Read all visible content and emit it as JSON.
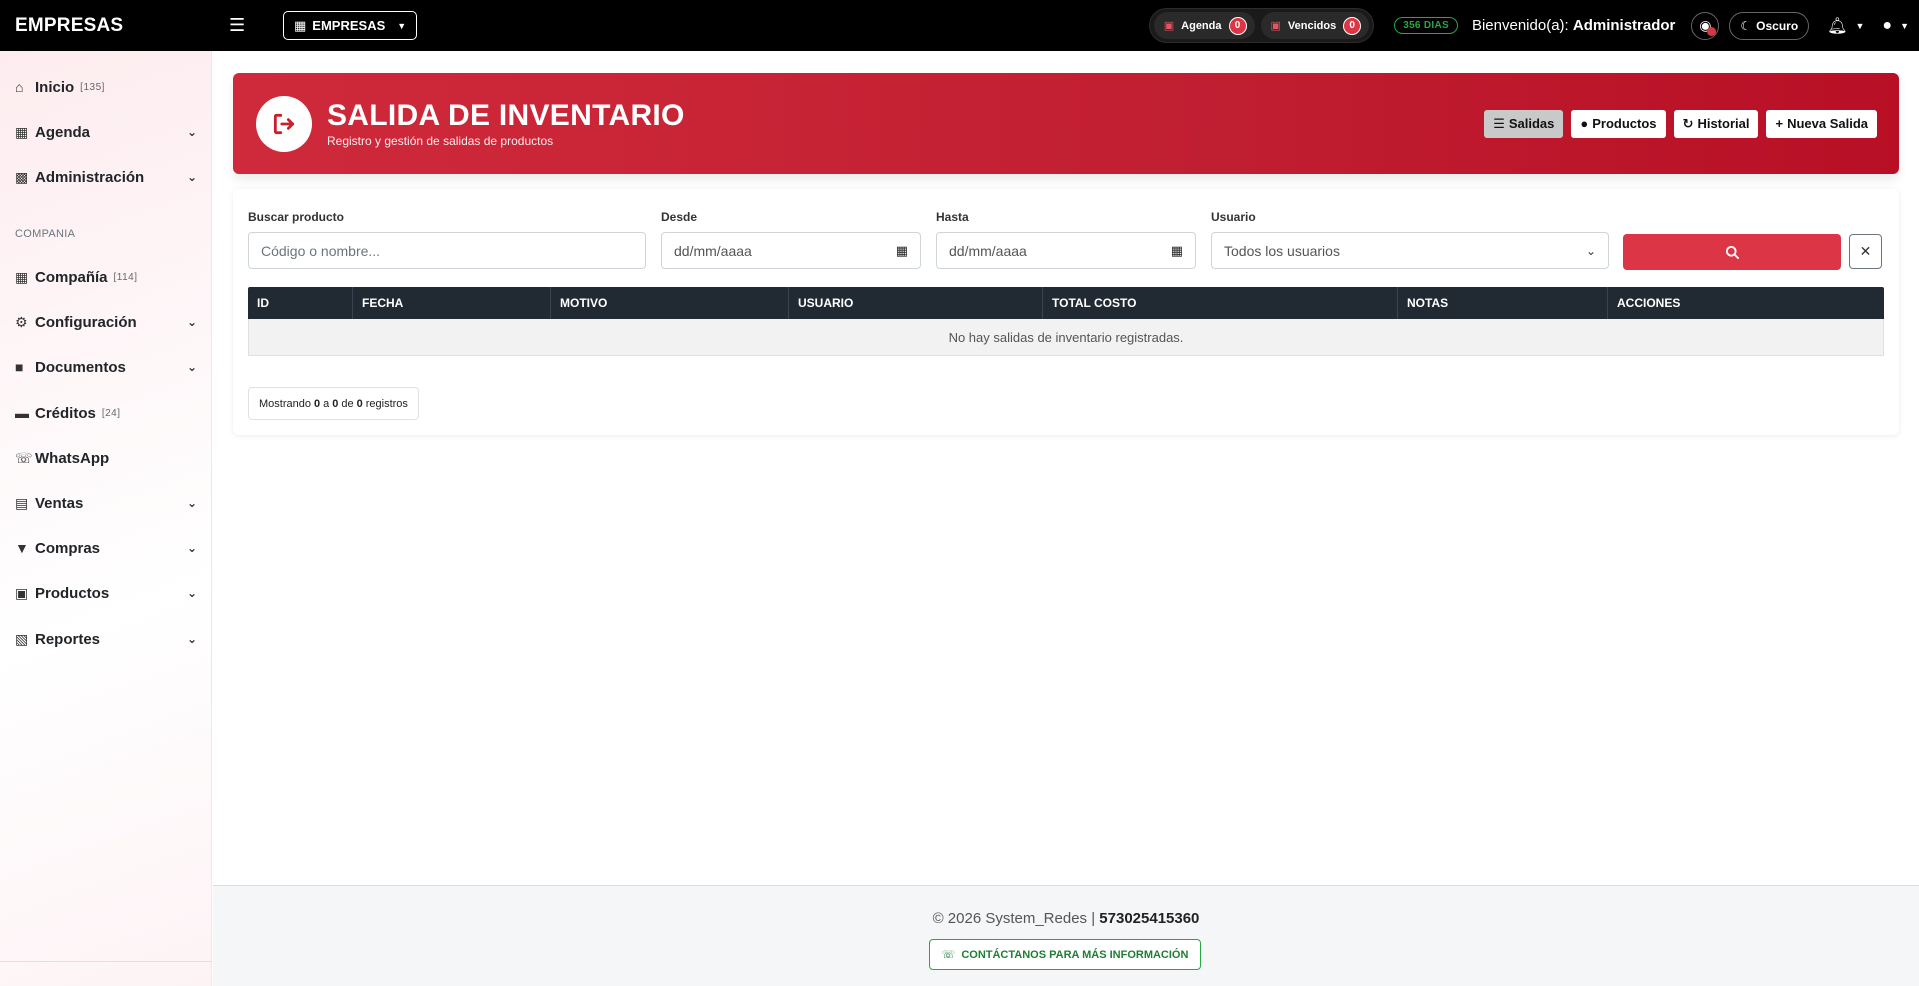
{
  "topbar": {
    "brand": "EMPRESAS",
    "company_selector": "EMPRESAS",
    "agenda_label": "Agenda",
    "agenda_count": "0",
    "vencidos_label": "Vencidos",
    "vencidos_count": "0",
    "days_badge": "356 DIAS",
    "welcome_prefix": "Bienvenido(a):",
    "welcome_user": "Administrador",
    "theme_label": "Oscuro"
  },
  "sidebar": {
    "items": [
      {
        "label": "Inicio",
        "count": "[135]",
        "icon": "home-icon"
      },
      {
        "label": "Agenda",
        "icon": "calendar-icon"
      },
      {
        "label": "Administración",
        "icon": "id-card-icon"
      },
      {
        "label": "Compañía",
        "count": "[114]",
        "icon": "building-icon"
      },
      {
        "label": "Configuración",
        "icon": "gears-icon"
      },
      {
        "label": "Documentos",
        "icon": "folder-icon"
      },
      {
        "label": "Créditos",
        "count": "[24]",
        "icon": "credit-card-icon"
      },
      {
        "label": "WhatsApp",
        "icon": "whatsapp-icon"
      },
      {
        "label": "Ventas",
        "icon": "cash-register-icon"
      },
      {
        "label": "Compras",
        "icon": "cart-icon"
      },
      {
        "label": "Productos",
        "icon": "boxes-icon"
      },
      {
        "label": "Reportes",
        "icon": "chart-icon"
      }
    ],
    "section_label": "COMPANIA"
  },
  "banner": {
    "title": "SALIDA DE INVENTARIO",
    "subtitle": "Registro y gestión de salidas de productos",
    "buttons": [
      "Salidas",
      "Productos",
      "Historial",
      "Nueva Salida"
    ]
  },
  "filters": {
    "search_label": "Buscar producto",
    "search_placeholder": "Código o nombre...",
    "from_label": "Desde",
    "from_value": "dd/mm/aaaa",
    "to_label": "Hasta",
    "to_value": "dd/mm/aaaa",
    "user_label": "Usuario",
    "user_value": "Todos los usuarios"
  },
  "table": {
    "columns": [
      "ID",
      "FECHA",
      "MOTIVO",
      "USUARIO",
      "TOTAL COSTO",
      "NOTAS",
      "ACCIONES"
    ],
    "empty_message": "No hay salidas de inventario registradas."
  },
  "pagination": {
    "prefix": "Mostrando",
    "from": "0",
    "a": "a",
    "to": "0",
    "de": "de",
    "total": "0",
    "suffix": "registros"
  },
  "footer": {
    "copyright": "© 2026 System_Redes |",
    "phone": "573025415360",
    "contact_button": "CONTÁCTANOS PARA MÁS INFORMACIÓN"
  },
  "colors": {
    "accent": "#dc3545",
    "success": "#28a745",
    "table_header": "#212a33"
  }
}
